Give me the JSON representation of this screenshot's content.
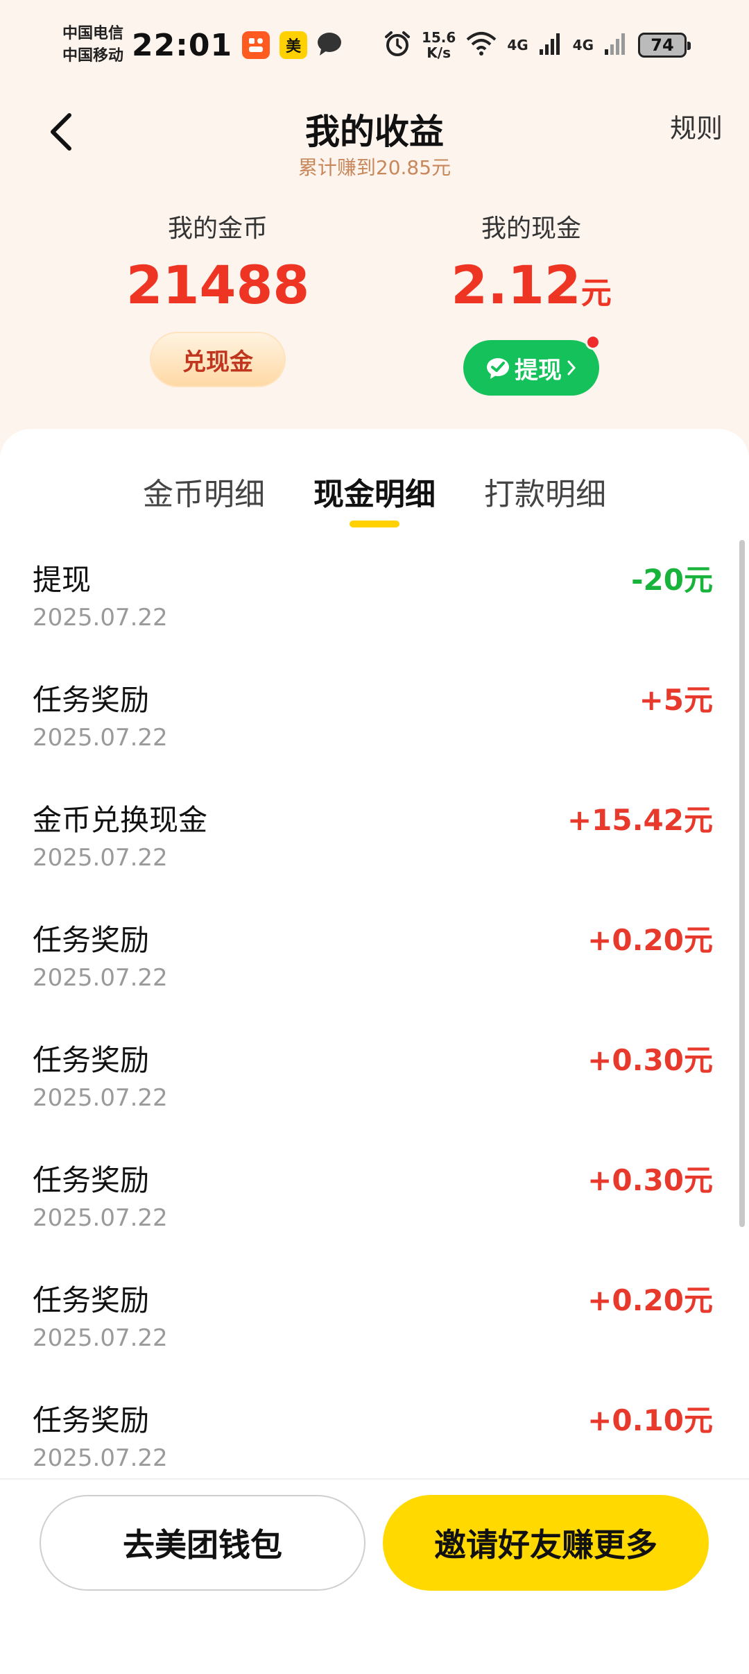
{
  "status_bar": {
    "carrier_1": "中国电信",
    "carrier_2": "中国移动",
    "time": "22:01",
    "app_badge_2": "美",
    "speed_value": "15.6",
    "speed_unit": "K/s",
    "net_1": "4G",
    "net_2": "4G",
    "battery": "74"
  },
  "header": {
    "title": "我的收益",
    "subtitle": "累计赚到20.85元",
    "rules": "规则"
  },
  "balances": {
    "coins_label": "我的金币",
    "coins_value": "21488",
    "exchange_button": "兑现金",
    "cash_label": "我的现金",
    "cash_value": "2.12",
    "cash_unit": "元",
    "withdraw_button": "提现"
  },
  "tabs": [
    {
      "label": "金币明细"
    },
    {
      "label": "现金明细"
    },
    {
      "label": "打款明细"
    }
  ],
  "records": [
    {
      "title": "提现",
      "date": "2025.07.22",
      "amount": "-20元"
    },
    {
      "title": "任务奖励",
      "date": "2025.07.22",
      "amount": "+5元"
    },
    {
      "title": "金币兑换现金",
      "date": "2025.07.22",
      "amount": "+15.42元"
    },
    {
      "title": "任务奖励",
      "date": "2025.07.22",
      "amount": "+0.20元"
    },
    {
      "title": "任务奖励",
      "date": "2025.07.22",
      "amount": "+0.30元"
    },
    {
      "title": "任务奖励",
      "date": "2025.07.22",
      "amount": "+0.30元"
    },
    {
      "title": "任务奖励",
      "date": "2025.07.22",
      "amount": "+0.20元"
    },
    {
      "title": "任务奖励",
      "date": "2025.07.22",
      "amount": "+0.10元"
    }
  ],
  "bottom": {
    "wallet_button": "去美团钱包",
    "invite_button": "邀请好友赚更多"
  },
  "colors": {
    "accent_red": "#ee3524",
    "withdraw_green": "#15c15a",
    "negative_green": "#18b33a",
    "brand_yellow": "#ffd900",
    "page_background": "#fdf4ee"
  }
}
